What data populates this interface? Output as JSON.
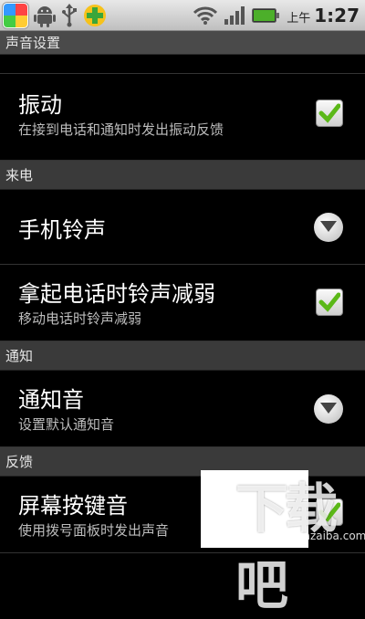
{
  "status_bar": {
    "app_icons": [
      "photos-app-icon",
      "android-icon",
      "usb-icon",
      "security-plus-icon"
    ],
    "am_pm": "上午",
    "time": "1:27",
    "colors": {
      "battery": "#4caf2a",
      "wifi": "#555555"
    }
  },
  "page": {
    "title": "声音设置"
  },
  "items": {
    "vibrate": {
      "title": "振动",
      "subtitle": "在接到电话和通知时发出振动反馈",
      "checked": true
    },
    "ringtone": {
      "title": "手机铃声"
    },
    "pickup_quiet": {
      "title": "拿起电话时铃声减弱",
      "subtitle": "移动电话时铃声减弱",
      "checked": true
    },
    "notification_sound": {
      "title": "通知音",
      "subtitle": "设置默认通知音"
    },
    "key_tone": {
      "title": "屏幕按键音",
      "subtitle": "使用拨号面板时发出声音",
      "checked": true
    }
  },
  "sections": {
    "incoming_call": "来电",
    "notification": "通知",
    "feedback": "反馈"
  },
  "watermark": {
    "text": "下载吧",
    "url": "www.xiazaiba.com"
  },
  "colors": {
    "check_green": "#5bb818"
  }
}
